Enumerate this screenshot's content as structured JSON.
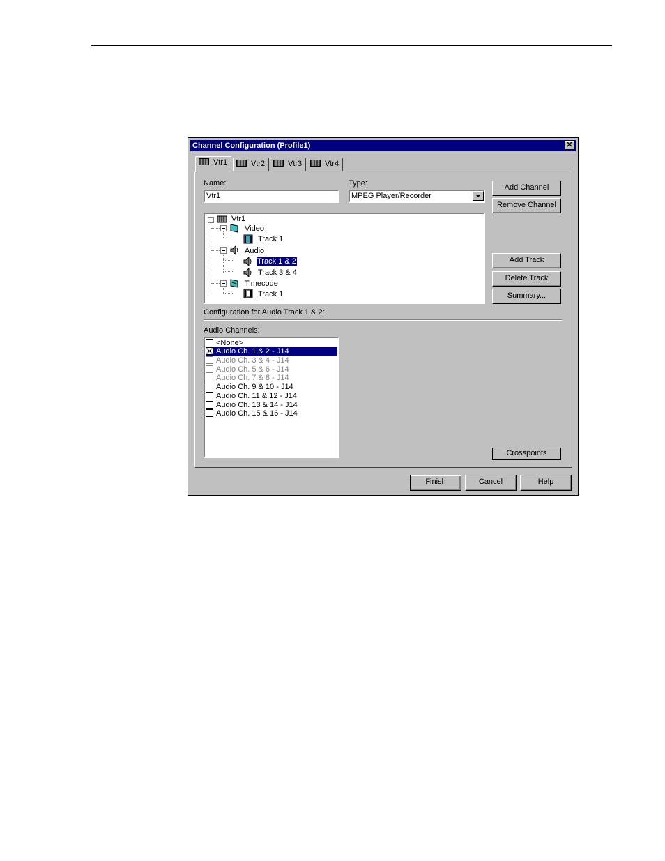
{
  "dialog": {
    "title": "Channel Configuration (Profile1)",
    "close_glyph": "✕"
  },
  "tabs": [
    {
      "label": "Vtr1",
      "active": true
    },
    {
      "label": "Vtr2",
      "active": false
    },
    {
      "label": "Vtr3",
      "active": false
    },
    {
      "label": "Vtr4",
      "active": false
    }
  ],
  "name_field": {
    "label": "Name:",
    "value": "Vtr1"
  },
  "type_field": {
    "label": "Type:",
    "value": "MPEG Player/Recorder"
  },
  "buttons": {
    "add_channel": "Add Channel",
    "remove_channel": "Remove Channel",
    "add_track": "Add Track",
    "delete_track": "Delete Track",
    "summary": "Summary...",
    "crosspoints": "Crosspoints",
    "finish": "Finish",
    "cancel": "Cancel",
    "help": "Help"
  },
  "tree": {
    "root": "Vtr1",
    "video": "Video",
    "video_track1": "Track 1",
    "audio": "Audio",
    "audio_track12": "Track 1 & 2",
    "audio_track34": "Track 3 & 4",
    "timecode": "Timecode",
    "timecode_track1": "Track 1"
  },
  "config_label": "Configuration for Audio Track 1 & 2:",
  "audio_channels": {
    "label": "Audio Channels:",
    "items": [
      {
        "label": "<None>",
        "checked": false,
        "selected": false,
        "disabled": false
      },
      {
        "label": "Audio Ch. 1 & 2 - J14",
        "checked": true,
        "selected": true,
        "disabled": false
      },
      {
        "label": "Audio Ch. 3 & 4 - J14",
        "checked": false,
        "selected": false,
        "disabled": true
      },
      {
        "label": "Audio Ch. 5 & 6 - J14",
        "checked": false,
        "selected": false,
        "disabled": true
      },
      {
        "label": "Audio Ch. 7 & 8 - J14",
        "checked": false,
        "selected": false,
        "disabled": true
      },
      {
        "label": "Audio Ch. 9 & 10 - J14",
        "checked": false,
        "selected": false,
        "disabled": false
      },
      {
        "label": "Audio Ch. 11 & 12 - J14",
        "checked": false,
        "selected": false,
        "disabled": false
      },
      {
        "label": "Audio Ch. 13 & 14 - J14",
        "checked": false,
        "selected": false,
        "disabled": false
      },
      {
        "label": "Audio Ch. 15 & 16 - J14",
        "checked": false,
        "selected": false,
        "disabled": false
      }
    ]
  },
  "colors": {
    "title_bar": "#000080",
    "selection": "#000080",
    "face": "#c0c0c0"
  }
}
